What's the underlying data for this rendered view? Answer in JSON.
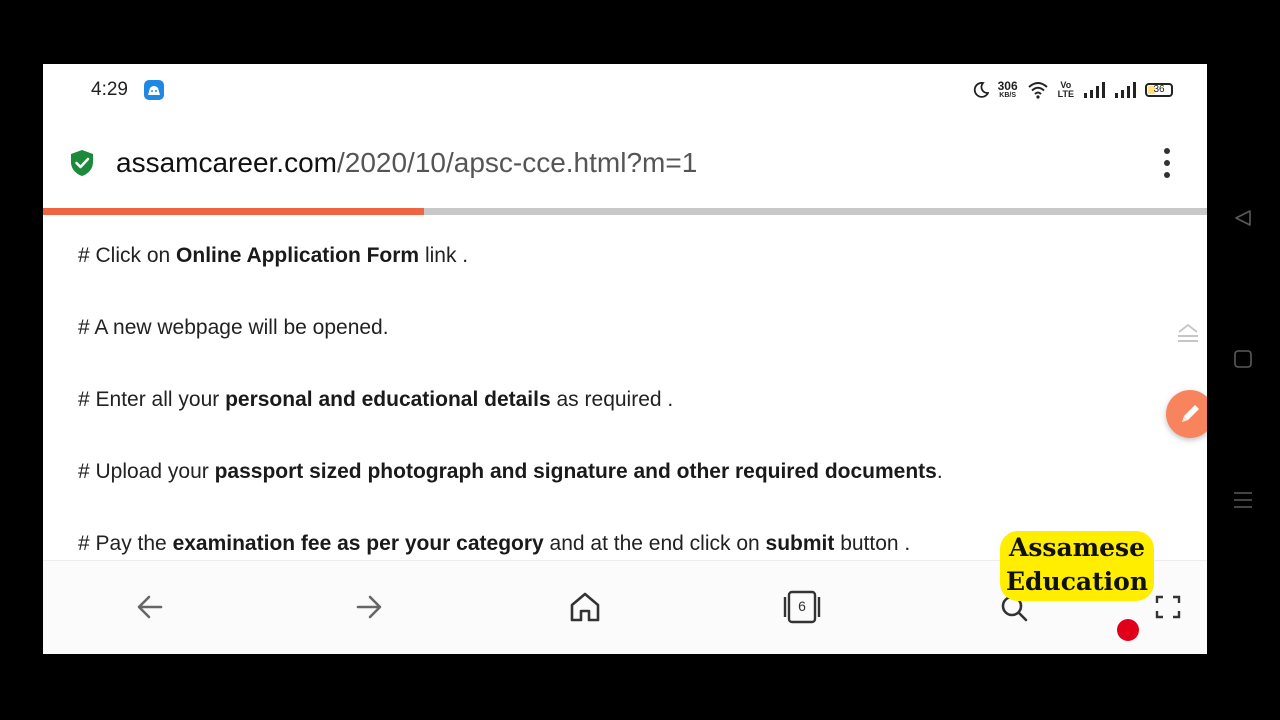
{
  "status_bar": {
    "time": "4:29",
    "net_speed_value": "306",
    "net_speed_unit": "KB/S",
    "volte_top": "Vo",
    "volte_bottom": "LTE",
    "battery": "36",
    "battery_level": 0.36,
    "battery_color": "#ffe082"
  },
  "url_bar": {
    "domain": "assamcareer.com",
    "path": "/2020/10/apsc-cce.html?m=1",
    "secure_icon": "shield-check-icon",
    "menu_icon": "more-vert-icon"
  },
  "load_progress": 0.327,
  "colors": {
    "progress": "#f06441",
    "secure": "#1b8a3a",
    "fab": "#f7845d",
    "watermark_bg": "#ffee00",
    "record": "#e0001a"
  },
  "content": {
    "lines": [
      {
        "parts": [
          {
            "t": "# Click on ",
            "b": false
          },
          {
            "t": "Online Application Form",
            "b": true
          },
          {
            "t": " link .",
            "b": false
          }
        ]
      },
      {
        "parts": [
          {
            "t": "# A new webpage will be opened.",
            "b": false
          }
        ]
      },
      {
        "parts": [
          {
            "t": "# Enter all your ",
            "b": false
          },
          {
            "t": "personal and educational details",
            "b": true
          },
          {
            "t": " as required .",
            "b": false
          }
        ]
      },
      {
        "parts": [
          {
            "t": "# Upload your ",
            "b": false
          },
          {
            "t": "passport sized photograph and signature and other required documents",
            "b": true
          },
          {
            "t": ".",
            "b": false
          }
        ]
      },
      {
        "parts": [
          {
            "t": "# Pay the ",
            "b": false
          },
          {
            "t": "examination fee as per your category",
            "b": true
          },
          {
            "t": " and at the end click on ",
            "b": false
          },
          {
            "t": "submit",
            "b": true
          },
          {
            "t": " button .",
            "b": false
          }
        ]
      }
    ]
  },
  "bottom_nav": {
    "tabs_count": "6",
    "items": [
      "back-arrow-icon",
      "forward-arrow-icon",
      "home-icon",
      "tabs-icon",
      "fullscreen-icon"
    ]
  },
  "watermark": {
    "line1": "Assamese",
    "line2": "Education"
  }
}
